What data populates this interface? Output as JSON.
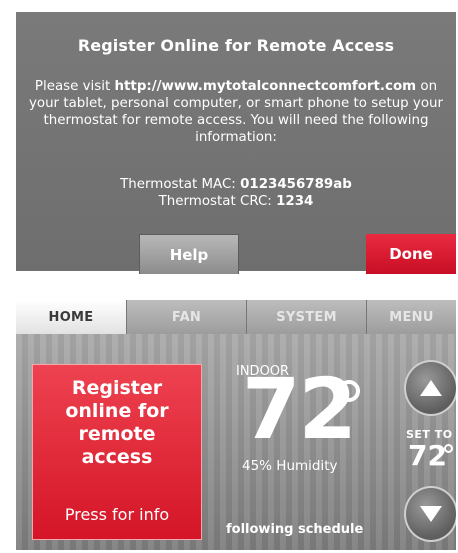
{
  "register_dialog": {
    "title": "Register Online for Remote Access",
    "body_prefix": "Please visit ",
    "url": "http://www.mytotalconnectcomfort.com",
    "body_suffix": " on your tablet, personal computer, or smart phone to setup your thermostat for remote access.  You will need the following information:",
    "mac_label": "Thermostat MAC: ",
    "mac_value": "0123456789ab",
    "crc_label": "Thermostat CRC: ",
    "crc_value": "1234",
    "help_label": "Help",
    "done_label": "Done",
    "colors": {
      "background": "#727272",
      "done_button": "#d8182c"
    }
  },
  "home_screen": {
    "tabs": [
      {
        "label": "HOME",
        "active": true
      },
      {
        "label": "FAN"
      },
      {
        "label": "SYSTEM"
      },
      {
        "label": "MENU"
      }
    ],
    "register_card": {
      "message": "Register online for remote access",
      "hint": "Press for info"
    },
    "indoor_label": "INDOOR",
    "indoor_temp": "72",
    "humidity": "45% Humidity",
    "set_to_label": "SET TO",
    "set_to_value": "72",
    "schedule_status": "following schedule",
    "icons": {
      "up": "up-arrow-icon",
      "down": "down-arrow-icon"
    },
    "colors": {
      "card": "#e0283a",
      "background": "#8f8f8f"
    }
  }
}
